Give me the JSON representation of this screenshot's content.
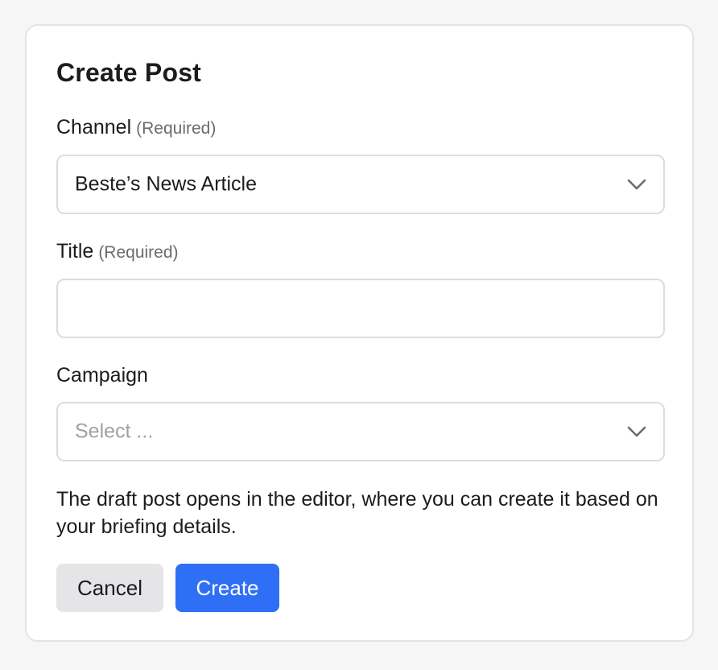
{
  "dialog": {
    "title": "Create Post",
    "channel": {
      "label": "Channel",
      "required_note": "(Required)",
      "selected_value": "Beste’s News Article"
    },
    "title_field": {
      "label": "Title",
      "required_note": "(Required)",
      "value": "",
      "placeholder": ""
    },
    "campaign": {
      "label": "Campaign",
      "placeholder": "Select ..."
    },
    "helper_text": "The draft post opens in the editor, where you can create it based on your briefing details.",
    "buttons": {
      "cancel_label": "Cancel",
      "create_label": "Create"
    },
    "icons": {
      "dropdown": "chevron-down-icon"
    },
    "colors": {
      "primary": "#2f6ff5",
      "secondary_button": "#e5e5e7",
      "border": "#dcdce0",
      "placeholder": "#a0a0a6"
    }
  }
}
